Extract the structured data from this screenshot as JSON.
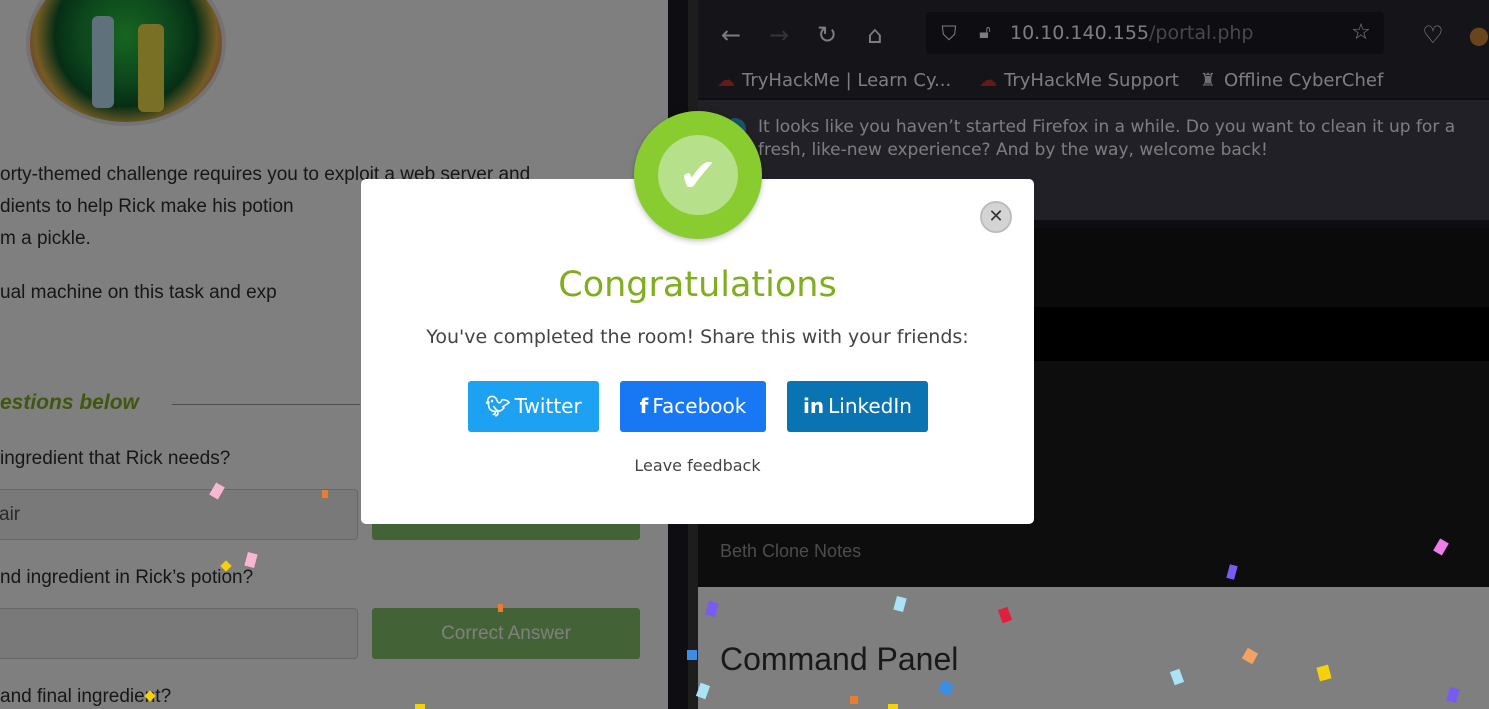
{
  "room": {
    "description_lines": [
      "orty-themed challenge requires you to exploit a web server and",
      "dients to help Rick make his potion",
      "m a pickle.",
      "ual machine on this task and exp"
    ],
    "questions_heading": "estions below",
    "questions": [
      {
        "text": "ingredient that Rick needs?",
        "answer": "air",
        "button": ""
      },
      {
        "text": "nd ingredient in Rick’s potion?",
        "answer": "",
        "button": "Correct Answer"
      },
      {
        "text": "and final ingredient?"
      }
    ]
  },
  "browser": {
    "url_host": "10.10.140.155",
    "url_path": "/portal.php",
    "bookmarks": [
      {
        "label": "TryHackMe | Learn Cy...",
        "icon": "cloud-icon"
      },
      {
        "label": "TryHackMe Support",
        "icon": "cloud-icon"
      },
      {
        "label": "Offline CyberChef",
        "icon": "chef-hat-icon"
      }
    ],
    "notice_text": "It looks like you haven’t started Firefox in a while. Do you want to clean it up for a fresh, like-new experience? And by the way, welcome back!",
    "page": {
      "beth_notes": "Beth Clone Notes",
      "command_title": "Command Panel"
    }
  },
  "modal": {
    "title": "Congratulations",
    "subtitle": "You've completed the room! Share this with your friends:",
    "buttons": [
      {
        "label": "Twitter",
        "icon": "twitter-icon",
        "color": "#1da1f2"
      },
      {
        "label": "Facebook",
        "icon": "facebook-icon",
        "color": "#1877f2"
      },
      {
        "label": "LinkedIn",
        "icon": "linkedin-icon",
        "color": "#0a74b3"
      }
    ],
    "feedback": "Leave feedback",
    "close_icon": "close-icon",
    "badge_icon": "check-badge-icon",
    "accent_color": "#7fae1e"
  }
}
